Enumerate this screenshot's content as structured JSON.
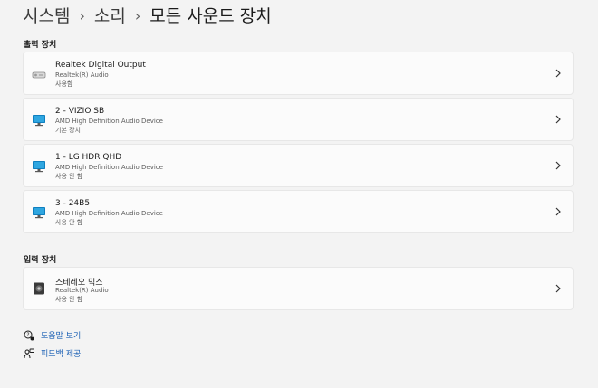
{
  "breadcrumb": {
    "system": "시스템",
    "sound": "소리",
    "current": "모든 사운드 장치"
  },
  "output_section": {
    "title": "출력 장치",
    "devices": [
      {
        "name": "Realtek Digital Output",
        "driver": "Realtek(R) Audio",
        "status": "사용함",
        "icon": "speaker-icon"
      },
      {
        "name": "2 - VIZIO SB",
        "driver": "AMD High Definition Audio Device",
        "status": "기본 장치",
        "icon": "monitor-icon"
      },
      {
        "name": "1 - LG HDR QHD",
        "driver": "AMD High Definition Audio Device",
        "status": "사용 안 함",
        "icon": "monitor-icon"
      },
      {
        "name": "3 - 24B5",
        "driver": "AMD High Definition Audio Device",
        "status": "사용 안 함",
        "icon": "monitor-icon"
      }
    ]
  },
  "input_section": {
    "title": "입력 장치",
    "devices": [
      {
        "name": "스테레오 믹스",
        "driver": "Realtek(R) Audio",
        "status": "사용 안 함",
        "icon": "stereo-mix-icon"
      }
    ]
  },
  "links": {
    "help": "도움말 보기",
    "feedback": "피드백 제공"
  },
  "colors": {
    "background": "#f3f3f3",
    "card": "#fbfbfb",
    "link": "#1a5fb4",
    "monitor": "#0f7fbf"
  }
}
